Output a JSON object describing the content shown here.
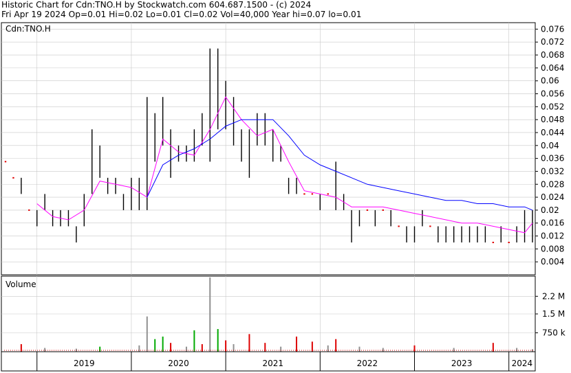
{
  "header": {
    "title": "Historic Chart for Cdn:TNO.H by Stockwatch.com 604.687.1500 - (c) 2024",
    "quote": "Fri Apr 19 2024   Op=0.01  Hi=0.02  Lo=0.01  Cl=0.02  Vol=40,000  Year hi=0.07  lo=0.01"
  },
  "colors": {
    "background": "#ffffff",
    "grid": "#c8c8c8",
    "price_bar": "#000000",
    "zero_volume_tick": "#e00000",
    "ma_short": "#ff00ff",
    "ma_long": "#0000ff",
    "volume_up": "#00aa00",
    "volume_down": "#dd0000",
    "volume_flat": "#909090"
  },
  "chart_data": [
    {
      "type": "ohlc",
      "panel_label": "Cdn:TNO.H",
      "x_labels": [
        "2019",
        "2020",
        "2021",
        "2022",
        "2023",
        "2024"
      ],
      "y_ticks": [
        "0.076",
        "0.072",
        "0.068",
        "0.064",
        "0.06",
        "0.056",
        "0.052",
        "0.048",
        "0.044",
        "0.04",
        "0.036",
        "0.032",
        "0.028",
        "0.024",
        "0.02",
        "0.016",
        "0.012",
        "0.008",
        "0.004"
      ],
      "ylim": [
        0,
        0.078
      ],
      "grid": true,
      "x_range": [
        "2018-09",
        "2024-04"
      ],
      "price_bars": [
        {
          "date": "2018-09",
          "high": 0.035,
          "low": 0.035
        },
        {
          "date": "2018-10",
          "high": 0.03,
          "low": 0.03
        },
        {
          "date": "2018-11",
          "high": 0.03,
          "low": 0.025
        },
        {
          "date": "2018-12",
          "high": 0.02,
          "low": 0.02
        },
        {
          "date": "2019-01",
          "high": 0.02,
          "low": 0.015
        },
        {
          "date": "2019-02",
          "high": 0.025,
          "low": 0.02
        },
        {
          "date": "2019-03",
          "high": 0.02,
          "low": 0.015
        },
        {
          "date": "2019-04",
          "high": 0.02,
          "low": 0.015
        },
        {
          "date": "2019-05",
          "high": 0.02,
          "low": 0.015
        },
        {
          "date": "2019-06",
          "high": 0.015,
          "low": 0.01
        },
        {
          "date": "2019-07",
          "high": 0.025,
          "low": 0.015
        },
        {
          "date": "2019-08",
          "high": 0.045,
          "low": 0.025
        },
        {
          "date": "2019-09",
          "high": 0.04,
          "low": 0.03
        },
        {
          "date": "2019-10",
          "high": 0.03,
          "low": 0.025
        },
        {
          "date": "2019-11",
          "high": 0.03,
          "low": 0.025
        },
        {
          "date": "2019-12",
          "high": 0.025,
          "low": 0.02
        },
        {
          "date": "2020-01",
          "high": 0.03,
          "low": 0.02
        },
        {
          "date": "2020-02",
          "high": 0.03,
          "low": 0.02
        },
        {
          "date": "2020-03",
          "high": 0.055,
          "low": 0.02
        },
        {
          "date": "2020-04",
          "high": 0.05,
          "low": 0.035
        },
        {
          "date": "2020-05",
          "high": 0.055,
          "low": 0.04
        },
        {
          "date": "2020-06",
          "high": 0.045,
          "low": 0.03
        },
        {
          "date": "2020-07",
          "high": 0.04,
          "low": 0.035
        },
        {
          "date": "2020-08",
          "high": 0.04,
          "low": 0.035
        },
        {
          "date": "2020-09",
          "high": 0.045,
          "low": 0.035
        },
        {
          "date": "2020-10",
          "high": 0.05,
          "low": 0.04
        },
        {
          "date": "2020-11",
          "high": 0.07,
          "low": 0.035
        },
        {
          "date": "2020-12",
          "high": 0.07,
          "low": 0.045
        },
        {
          "date": "2021-01",
          "high": 0.06,
          "low": 0.045
        },
        {
          "date": "2021-02",
          "high": 0.055,
          "low": 0.04
        },
        {
          "date": "2021-03",
          "high": 0.045,
          "low": 0.035
        },
        {
          "date": "2021-04",
          "high": 0.045,
          "low": 0.03
        },
        {
          "date": "2021-05",
          "high": 0.05,
          "low": 0.04
        },
        {
          "date": "2021-06",
          "high": 0.05,
          "low": 0.04
        },
        {
          "date": "2021-07",
          "high": 0.045,
          "low": 0.035
        },
        {
          "date": "2021-08",
          "high": 0.04,
          "low": 0.035
        },
        {
          "date": "2021-09",
          "high": 0.03,
          "low": 0.025
        },
        {
          "date": "2021-10",
          "high": 0.03,
          "low": 0.025
        },
        {
          "date": "2021-11",
          "high": 0.025,
          "low": 0.025
        },
        {
          "date": "2021-12",
          "high": 0.025,
          "low": 0.025
        },
        {
          "date": "2022-01",
          "high": 0.025,
          "low": 0.02
        },
        {
          "date": "2022-02",
          "high": 0.025,
          "low": 0.025
        },
        {
          "date": "2022-03",
          "high": 0.035,
          "low": 0.02
        },
        {
          "date": "2022-04",
          "high": 0.025,
          "low": 0.02
        },
        {
          "date": "2022-05",
          "high": 0.02,
          "low": 0.01
        },
        {
          "date": "2022-06",
          "high": 0.02,
          "low": 0.015
        },
        {
          "date": "2022-07",
          "high": 0.02,
          "low": 0.02
        },
        {
          "date": "2022-08",
          "high": 0.02,
          "low": 0.015
        },
        {
          "date": "2022-09",
          "high": 0.02,
          "low": 0.02
        },
        {
          "date": "2022-10",
          "high": 0.02,
          "low": 0.015
        },
        {
          "date": "2022-11",
          "high": 0.015,
          "low": 0.015
        },
        {
          "date": "2022-12",
          "high": 0.015,
          "low": 0.01
        },
        {
          "date": "2023-01",
          "high": 0.015,
          "low": 0.01
        },
        {
          "date": "2023-02",
          "high": 0.02,
          "low": 0.015
        },
        {
          "date": "2023-03",
          "high": 0.015,
          "low": 0.015
        },
        {
          "date": "2023-04",
          "high": 0.015,
          "low": 0.01
        },
        {
          "date": "2023-05",
          "high": 0.015,
          "low": 0.01
        },
        {
          "date": "2023-06",
          "high": 0.015,
          "low": 0.01
        },
        {
          "date": "2023-07",
          "high": 0.015,
          "low": 0.01
        },
        {
          "date": "2023-08",
          "high": 0.015,
          "low": 0.01
        },
        {
          "date": "2023-09",
          "high": 0.015,
          "low": 0.01
        },
        {
          "date": "2023-10",
          "high": 0.015,
          "low": 0.01
        },
        {
          "date": "2023-11",
          "high": 0.01,
          "low": 0.01
        },
        {
          "date": "2023-12",
          "high": 0.015,
          "low": 0.01
        },
        {
          "date": "2024-01",
          "high": 0.01,
          "low": 0.01
        },
        {
          "date": "2024-02",
          "high": 0.015,
          "low": 0.01
        },
        {
          "date": "2024-03",
          "high": 0.02,
          "low": 0.01
        },
        {
          "date": "2024-04",
          "high": 0.02,
          "low": 0.01
        }
      ],
      "series": [
        {
          "color": "#ff00ff",
          "points": [
            [
              "2019-01",
              0.022
            ],
            [
              "2019-03",
              0.018
            ],
            [
              "2019-05",
              0.017
            ],
            [
              "2019-07",
              0.02
            ],
            [
              "2019-09",
              0.029
            ],
            [
              "2019-11",
              0.028
            ],
            [
              "2020-01",
              0.027
            ],
            [
              "2020-03",
              0.024
            ],
            [
              "2020-05",
              0.042
            ],
            [
              "2020-07",
              0.038
            ],
            [
              "2020-09",
              0.037
            ],
            [
              "2020-11",
              0.045
            ],
            [
              "2021-01",
              0.055
            ],
            [
              "2021-03",
              0.048
            ],
            [
              "2021-05",
              0.043
            ],
            [
              "2021-07",
              0.045
            ],
            [
              "2021-09",
              0.035
            ],
            [
              "2021-11",
              0.026
            ],
            [
              "2022-01",
              0.025
            ],
            [
              "2022-03",
              0.024
            ],
            [
              "2022-05",
              0.021
            ],
            [
              "2022-07",
              0.021
            ],
            [
              "2022-09",
              0.021
            ],
            [
              "2022-11",
              0.02
            ],
            [
              "2023-01",
              0.019
            ],
            [
              "2023-03",
              0.018
            ],
            [
              "2023-05",
              0.017
            ],
            [
              "2023-07",
              0.016
            ],
            [
              "2023-09",
              0.016
            ],
            [
              "2023-11",
              0.015
            ],
            [
              "2024-01",
              0.014
            ],
            [
              "2024-03",
              0.013
            ],
            [
              "2024-04",
              0.016
            ]
          ]
        },
        {
          "color": "#0000ff",
          "points": [
            [
              "2020-03",
              0.024
            ],
            [
              "2020-05",
              0.034
            ],
            [
              "2020-07",
              0.037
            ],
            [
              "2020-09",
              0.039
            ],
            [
              "2020-11",
              0.042
            ],
            [
              "2021-01",
              0.046
            ],
            [
              "2021-03",
              0.048
            ],
            [
              "2021-05",
              0.048
            ],
            [
              "2021-07",
              0.048
            ],
            [
              "2021-09",
              0.043
            ],
            [
              "2021-11",
              0.037
            ],
            [
              "2022-01",
              0.034
            ],
            [
              "2022-03",
              0.032
            ],
            [
              "2022-05",
              0.03
            ],
            [
              "2022-07",
              0.028
            ],
            [
              "2022-09",
              0.027
            ],
            [
              "2022-11",
              0.026
            ],
            [
              "2023-01",
              0.025
            ],
            [
              "2023-03",
              0.024
            ],
            [
              "2023-05",
              0.023
            ],
            [
              "2023-07",
              0.023
            ],
            [
              "2023-09",
              0.022
            ],
            [
              "2023-11",
              0.022
            ],
            [
              "2024-01",
              0.021
            ],
            [
              "2024-03",
              0.021
            ],
            [
              "2024-04",
              0.02
            ]
          ]
        }
      ]
    },
    {
      "type": "bar",
      "panel_label": "Volume",
      "x_labels": [
        "2019",
        "2020",
        "2021",
        "2022",
        "2023",
        "2024"
      ],
      "y_ticks": [
        "2.2 M",
        "1.5 M",
        "750 k"
      ],
      "ylim": [
        0,
        3000000
      ],
      "x_range": [
        "2018-09",
        "2024-04"
      ],
      "bars": [
        {
          "date": "2018-11",
          "value": 300000,
          "color": "#dd0000"
        },
        {
          "date": "2019-02",
          "value": 150000,
          "color": "#909090"
        },
        {
          "date": "2019-06",
          "value": 120000,
          "color": "#909090"
        },
        {
          "date": "2019-09",
          "value": 200000,
          "color": "#00aa00"
        },
        {
          "date": "2020-02",
          "value": 250000,
          "color": "#909090"
        },
        {
          "date": "2020-03",
          "value": 1400000,
          "color": "#909090"
        },
        {
          "date": "2020-04",
          "value": 500000,
          "color": "#00aa00"
        },
        {
          "date": "2020-05",
          "value": 600000,
          "color": "#00aa00"
        },
        {
          "date": "2020-06",
          "value": 350000,
          "color": "#dd0000"
        },
        {
          "date": "2020-08",
          "value": 200000,
          "color": "#909090"
        },
        {
          "date": "2020-09",
          "value": 850000,
          "color": "#00aa00"
        },
        {
          "date": "2020-10",
          "value": 300000,
          "color": "#dd0000"
        },
        {
          "date": "2020-11",
          "value": 2950000,
          "color": "#909090"
        },
        {
          "date": "2020-12",
          "value": 900000,
          "color": "#00aa00"
        },
        {
          "date": "2021-01",
          "value": 450000,
          "color": "#dd0000"
        },
        {
          "date": "2021-02",
          "value": 300000,
          "color": "#909090"
        },
        {
          "date": "2021-04",
          "value": 700000,
          "color": "#dd0000"
        },
        {
          "date": "2021-06",
          "value": 350000,
          "color": "#dd0000"
        },
        {
          "date": "2021-08",
          "value": 200000,
          "color": "#909090"
        },
        {
          "date": "2021-10",
          "value": 600000,
          "color": "#dd0000"
        },
        {
          "date": "2021-12",
          "value": 400000,
          "color": "#dd0000"
        },
        {
          "date": "2022-02",
          "value": 250000,
          "color": "#909090"
        },
        {
          "date": "2022-03",
          "value": 500000,
          "color": "#dd0000"
        },
        {
          "date": "2022-06",
          "value": 200000,
          "color": "#909090"
        },
        {
          "date": "2022-09",
          "value": 150000,
          "color": "#909090"
        },
        {
          "date": "2023-01",
          "value": 250000,
          "color": "#dd0000"
        },
        {
          "date": "2023-06",
          "value": 150000,
          "color": "#909090"
        },
        {
          "date": "2023-11",
          "value": 350000,
          "color": "#dd0000"
        },
        {
          "date": "2024-02",
          "value": 150000,
          "color": "#909090"
        },
        {
          "date": "2024-04",
          "value": 100000,
          "color": "#909090"
        }
      ]
    }
  ]
}
